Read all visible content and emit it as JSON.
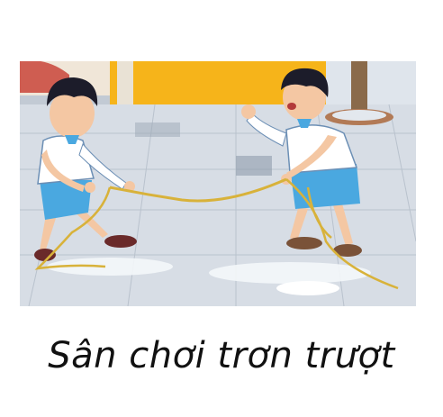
{
  "caption": "Sân chơi trơn trượt",
  "colors": {
    "wall_yellow": "#f6b41a",
    "floor_tile": "#d7dde5",
    "shirt": "#ffffff",
    "shorts": "#4aa8e0",
    "rope": "#d8b23a",
    "hair": "#1c1c2a",
    "skin": "#f4c7a3",
    "shoes": "#6a3a2a",
    "tree_trunk": "#8a6a4a"
  },
  "scene": {
    "characters": [
      "boy-pulling-rope-left",
      "boy-pulling-rope-right"
    ],
    "objects": [
      "rope",
      "wet-floor-puddle",
      "tree",
      "yellow-wall",
      "tiled-floor"
    ]
  }
}
